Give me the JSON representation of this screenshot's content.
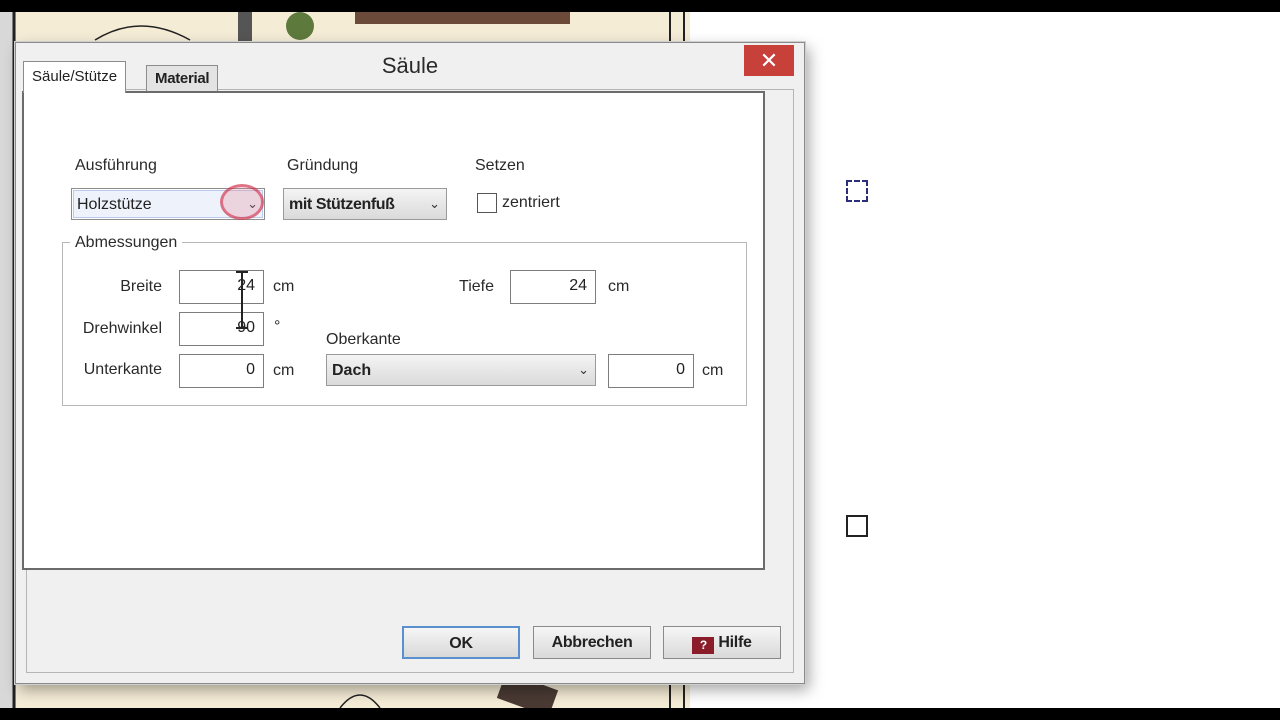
{
  "dialog": {
    "title": "Säule",
    "close_glyph": "✕",
    "tabs": [
      {
        "label": "Säule/Stütze",
        "active": true
      },
      {
        "label": "Material",
        "active": false
      }
    ],
    "ausfuehrung": {
      "label": "Ausführung",
      "value": "Holzstütze"
    },
    "gruendung": {
      "label": "Gründung",
      "value": "mit Stützenfuß"
    },
    "setzen": {
      "label": "Setzen",
      "checkbox_label": "zentriert",
      "checked": false
    },
    "abmessungen": {
      "title": "Abmessungen",
      "breite": {
        "label": "Breite",
        "value": "24",
        "unit": "cm"
      },
      "tiefe": {
        "label": "Tiefe",
        "value": "24",
        "unit": "cm"
      },
      "drehwinkel": {
        "label": "Drehwinkel",
        "value": "90",
        "unit": "°"
      },
      "unterkante": {
        "label": "Unterkante",
        "value": "0",
        "unit": "cm"
      },
      "oberkante": {
        "label": "Oberkante",
        "value": "Dach",
        "offset_value": "0",
        "unit": "cm"
      }
    },
    "buttons": {
      "ok": "OK",
      "cancel": "Abbrechen",
      "help": "Hilfe",
      "help_icon_glyph": "?"
    }
  },
  "dropdown_arrow_glyph": "⌄",
  "colors": {
    "close_button": "#c7403a",
    "ok_focus_border": "#5a8fd0",
    "plan_background": "#f5ecd6",
    "cursor_highlight": "#cd1e3c"
  }
}
